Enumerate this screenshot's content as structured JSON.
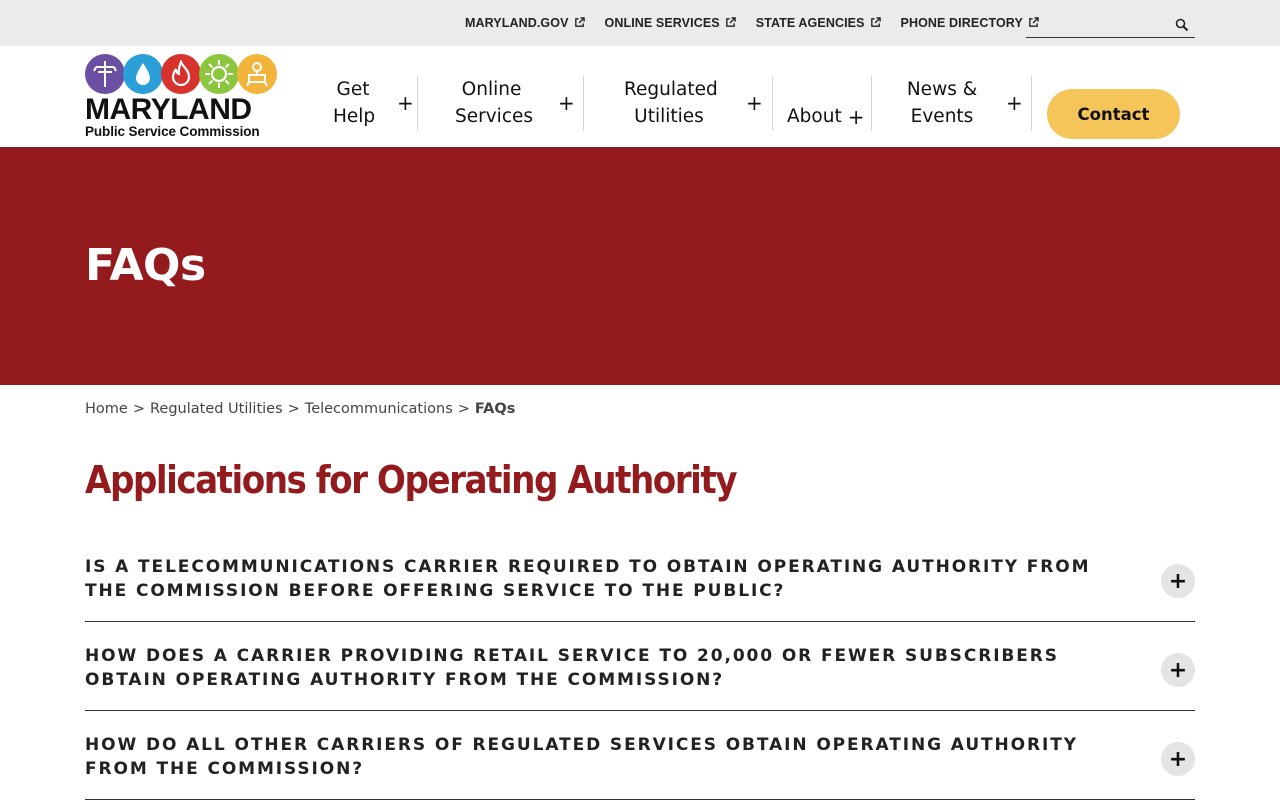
{
  "utility": {
    "links": [
      {
        "label": "MARYLAND.GOV"
      },
      {
        "label": "ONLINE SERVICES"
      },
      {
        "label": "STATE AGENCIES"
      },
      {
        "label": "PHONE DIRECTORY"
      }
    ],
    "search_placeholder": ""
  },
  "logo": {
    "word": "MARYLAND",
    "subtitle": "Public Service Commission",
    "circle_colors": [
      "#6a4fa3",
      "#2a9fd8",
      "#d8322c",
      "#8cc63e",
      "#f3b43c"
    ]
  },
  "nav": {
    "get_help": "Get Help",
    "online_services": "Online Services",
    "regulated_utilities": "Regulated Utilities",
    "about": "About",
    "news_events": "News & Events",
    "contact": "Contact",
    "plus": "+"
  },
  "hero": {
    "title": "FAQs",
    "color": "#931b1e"
  },
  "breadcrumb": {
    "items": [
      "Home",
      "Regulated Utilities",
      "Telecommunications",
      "FAQs"
    ],
    "separator": ">"
  },
  "section": {
    "title": "Applications for Operating Authority"
  },
  "faqs": [
    {
      "question": "Is a telecommunications carrier required to obtain operating authority from the Commission before offering service to the public?"
    },
    {
      "question": "How does a carrier providing retail service to 20,000 or fewer subscribers obtain operating authority from the Commission?"
    },
    {
      "question": "How do all other carriers of regulated services obtain operating authority from the Commission?"
    }
  ],
  "faq_toggle_symbol": "+"
}
